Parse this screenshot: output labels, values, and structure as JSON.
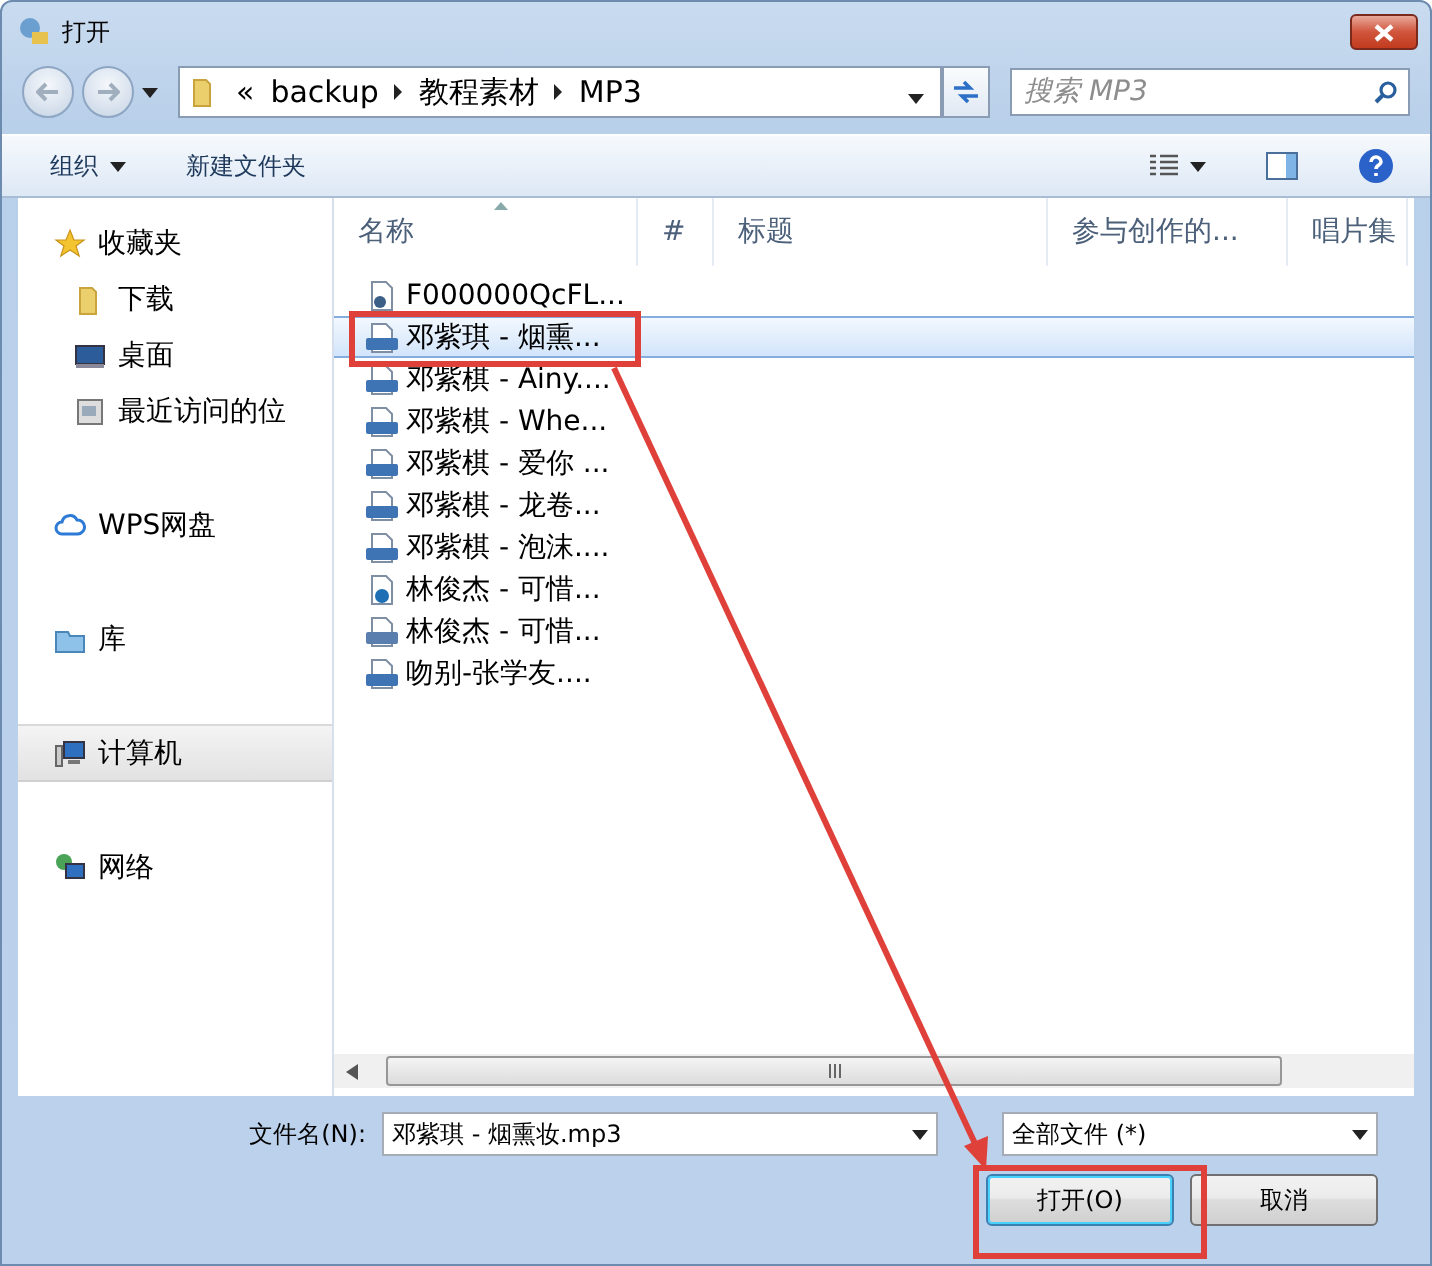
{
  "window": {
    "title": "打开"
  },
  "breadcrumb": {
    "overflow": "«",
    "segments": [
      "backup",
      "教程素材",
      "MP3"
    ]
  },
  "search": {
    "placeholder": "搜索 MP3"
  },
  "toolbar": {
    "organize": "组织",
    "new_folder": "新建文件夹"
  },
  "sidebar": [
    {
      "label": "收藏夹",
      "selected": false,
      "children": [
        {
          "label": "下载",
          "selected": false
        },
        {
          "label": "桌面",
          "selected": false
        },
        {
          "label": "最近访问的位",
          "selected": false
        }
      ]
    },
    {
      "label": "WPS网盘",
      "selected": false
    },
    {
      "label": "库",
      "selected": false
    },
    {
      "label": "计算机",
      "selected": true
    },
    {
      "label": "网络",
      "selected": false
    }
  ],
  "columns": [
    "名称",
    "#",
    "标题",
    "参与创作的...",
    "唱片集"
  ],
  "files": [
    {
      "name": "F000000QcFL...",
      "kind": "generic",
      "selected": false
    },
    {
      "name": "邓紫琪 - 烟熏...",
      "kind": "mp3",
      "selected": true
    },
    {
      "name": "邓紫棋 - Ainy....",
      "kind": "mp3",
      "selected": false
    },
    {
      "name": "邓紫棋 - Whe...",
      "kind": "mp3",
      "selected": false
    },
    {
      "name": "邓紫棋 - 爱你 ...",
      "kind": "mp3",
      "selected": false
    },
    {
      "name": "邓紫棋 - 龙卷...",
      "kind": "mp3",
      "selected": false
    },
    {
      "name": "邓紫棋 - 泡沫....",
      "kind": "mp3",
      "selected": false
    },
    {
      "name": "林俊杰 - 可惜...",
      "kind": "audio",
      "selected": false
    },
    {
      "name": "林俊杰 - 可惜...",
      "kind": "wav",
      "selected": false
    },
    {
      "name": "吻别-张学友....",
      "kind": "mp3",
      "selected": false
    }
  ],
  "filename": {
    "label": "文件名(N):",
    "value": "邓紫琪 - 烟熏妆.mp3"
  },
  "filetype": {
    "value": "全部文件 (*)"
  },
  "buttons": [
    {
      "label": "打开(O)",
      "kind": "primary"
    },
    {
      "label": "取消",
      "kind": "normal"
    }
  ]
}
